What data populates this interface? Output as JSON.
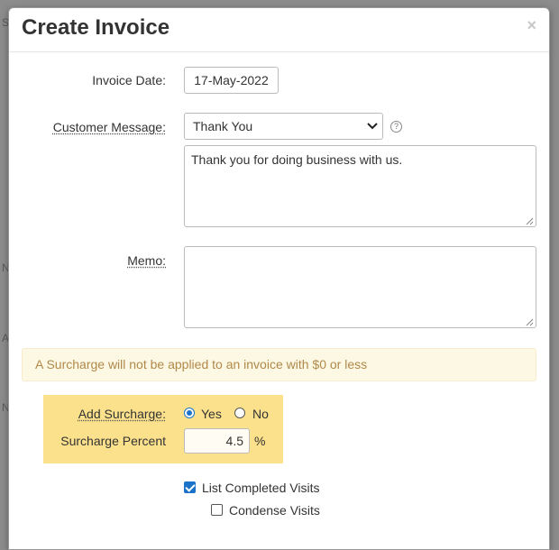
{
  "background": {
    "letters": [
      "S",
      "N",
      "A",
      "N"
    ]
  },
  "modal": {
    "title": "Create Invoice",
    "close_symbol": "×"
  },
  "form": {
    "invoice_date": {
      "label": "Invoice Date:",
      "value": "17-May-2022"
    },
    "customer_message": {
      "label": "Customer Message:",
      "selected": "Thank You",
      "help_icon": "question-circle-icon",
      "text": "Thank you for doing business with us."
    },
    "memo": {
      "label": "Memo:",
      "value": ""
    },
    "alert": "A Surcharge will not be applied to an invoice with $0 or less",
    "add_surcharge": {
      "label": "Add Surcharge:",
      "yes_label": "Yes",
      "no_label": "No",
      "selected": "Yes"
    },
    "surcharge_percent": {
      "label": "Surcharge Percent",
      "value": "4.5",
      "unit": "%"
    },
    "list_completed_visits": {
      "label": "List Completed Visits",
      "checked": true
    },
    "condense_visits": {
      "label": "Condense Visits",
      "checked": false
    }
  },
  "colors": {
    "accent": "#1a73c9",
    "alert_bg": "#fcf8e3",
    "alert_text": "#b0894a",
    "surcharge_highlight": "#fbe18c"
  }
}
